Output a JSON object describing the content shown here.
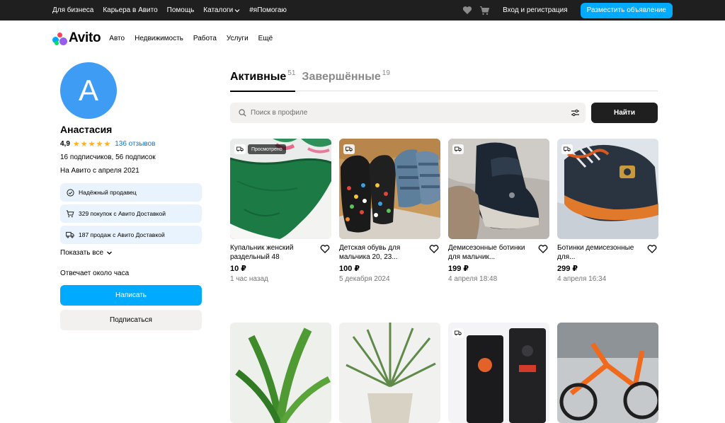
{
  "topbar": {
    "links": [
      "Для бизнеса",
      "Карьера в Авито",
      "Помощь",
      "Каталоги",
      "#яПомогаю"
    ],
    "login_label": "Вход и регистрация",
    "post_button_label": "Разместить объявление"
  },
  "nav": {
    "logo_text": "Avito",
    "items": [
      "Авто",
      "Недвижимость",
      "Работа",
      "Услуги",
      "Ещё"
    ]
  },
  "profile": {
    "avatar_letter": "А",
    "name": "Анастасия",
    "rating": "4,9",
    "stars": "★★★★★",
    "reviews": "136 отзывов",
    "subscribers": "16 подписчиков, 56 подписок",
    "since": "На Авито с апреля 2021",
    "badges": [
      "Надёжный продавец",
      "329 покупок с Авито Доставкой",
      "187 продаж с Авито Доставкой"
    ],
    "show_all": "Показать все",
    "reply_time": "Отвечает около часа",
    "write_button": "Написать",
    "subscribe_button": "Подписаться"
  },
  "tabs": [
    {
      "label": "Активные",
      "count": "51"
    },
    {
      "label": "Завершённые",
      "count": "19"
    }
  ],
  "search": {
    "placeholder": "Поиск в профиле",
    "button_label": "Найти"
  },
  "listings": [
    {
      "title": "Купальник женский раздельный 48",
      "price": "10 ₽",
      "date": "1 час назад",
      "badge": "Просмотрено"
    },
    {
      "title": "Детская обувь для мальчика 20, 23...",
      "price": "100 ₽",
      "date": "5 декабря 2024"
    },
    {
      "title": "Демисезонные ботинки для мальчик...",
      "price": "199 ₽",
      "date": "4 апреля 18:48"
    },
    {
      "title": "Ботинки демисезонные для...",
      "price": "299 ₽",
      "date": "4 апреля 16:34"
    }
  ],
  "icons": {
    "topbar": [
      "heart-icon",
      "cart-icon"
    ],
    "badges": [
      "shield-check-icon",
      "cart-icon",
      "truck-icon"
    ],
    "search": [
      "search-icon",
      "filter-icon"
    ]
  },
  "colors": {
    "accent": "#00aaff",
    "avatar": "#3e9cf5",
    "badge_bg": "#e8f3fd",
    "stars": "#ffb021",
    "reviews_link": "#0a74d9"
  }
}
